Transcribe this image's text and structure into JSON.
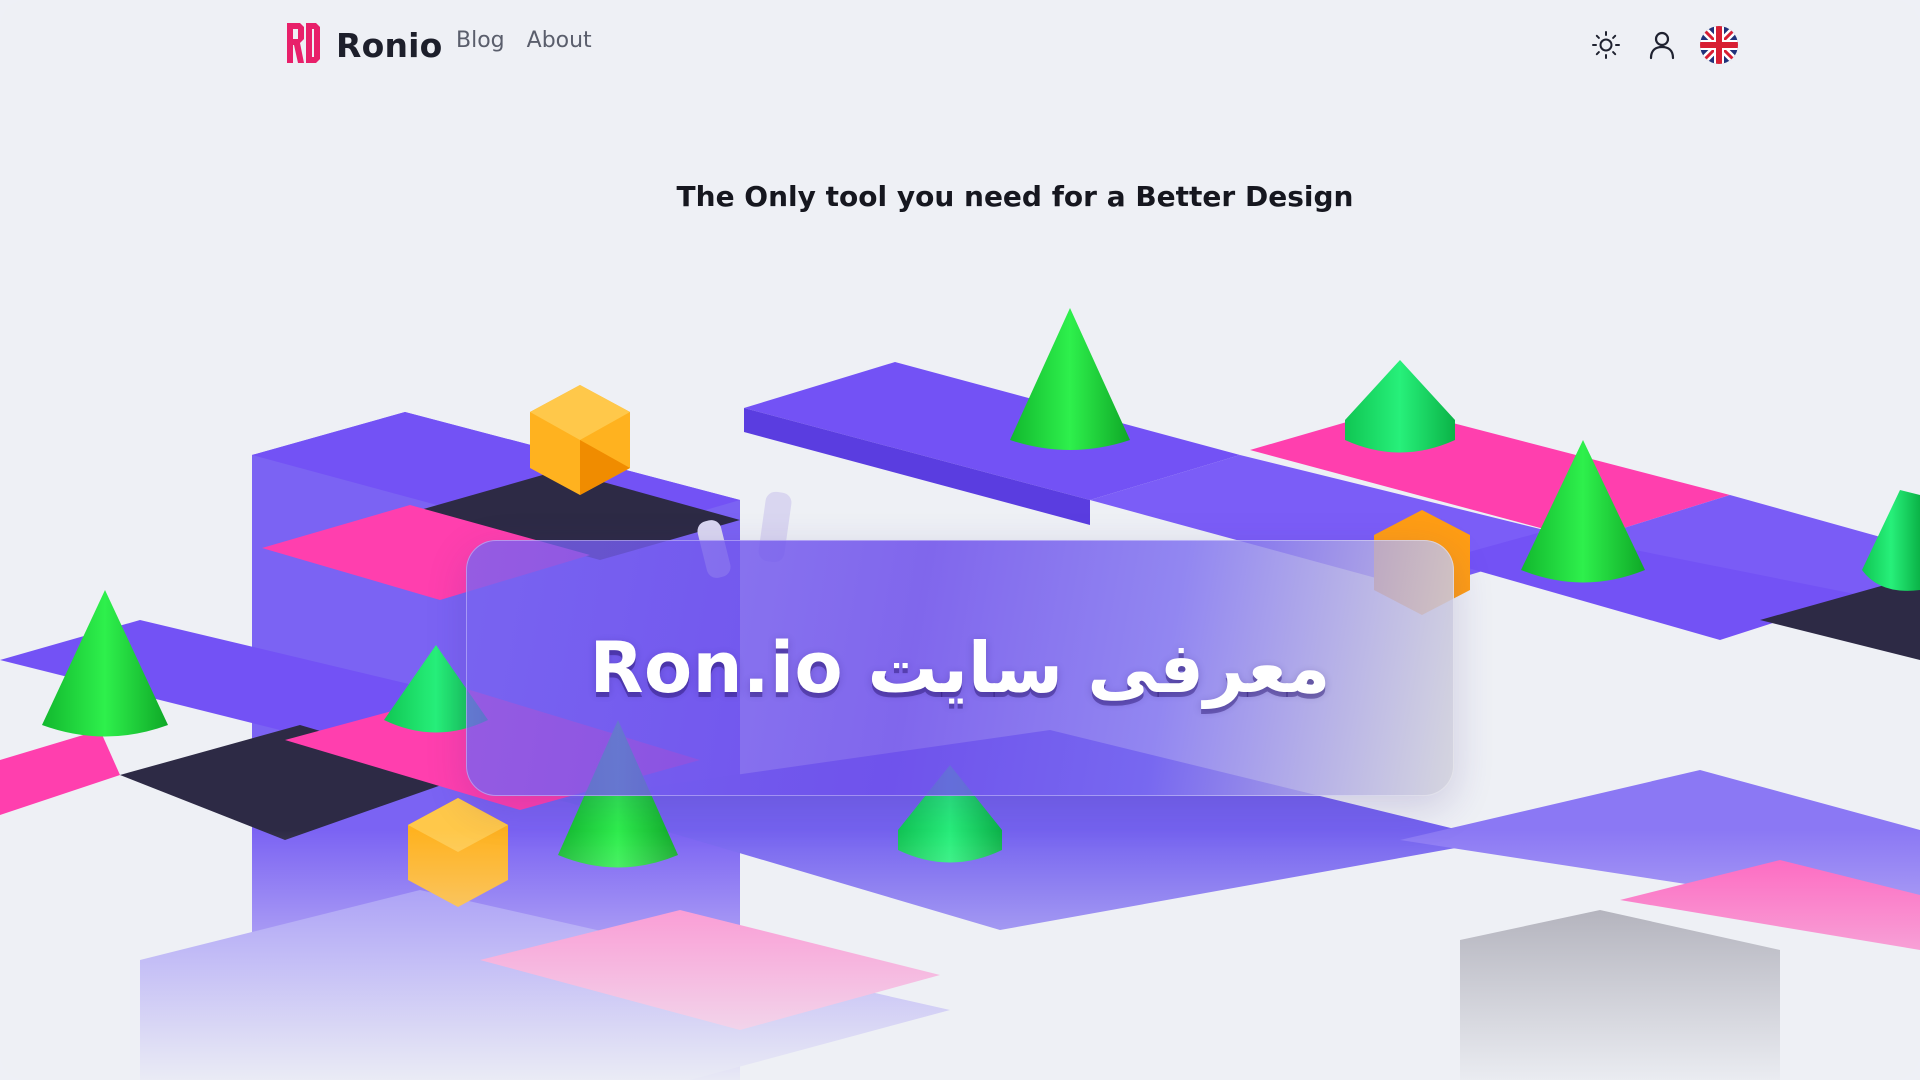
{
  "header": {
    "brand_name": "Ronio",
    "nav": [
      {
        "label": "Blog"
      },
      {
        "label": "About"
      }
    ],
    "icons": [
      "sun-icon",
      "user-icon",
      "uk-flag-icon"
    ]
  },
  "hero": {
    "tagline": "The Only tool you need for a Better Design",
    "banner_title": "معرفی سایت Ron.io"
  },
  "colors": {
    "brand_accent": "#e8206a",
    "tile_purple": "#7352f5",
    "tile_pink": "#ff3fae",
    "tile_dark": "#2d2a45",
    "cone_green": "#19d63c",
    "gem_orange": "#ffa51c"
  }
}
